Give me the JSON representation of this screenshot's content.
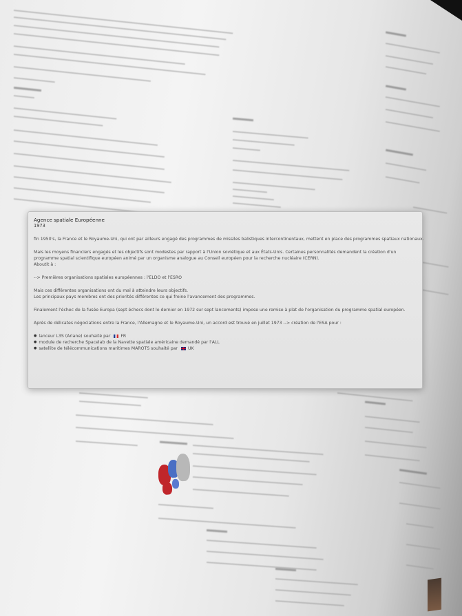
{
  "popover": {
    "title": "Agence spatiale Européenne",
    "year": "1973",
    "paragraphs": [
      "fin 1950's, la France et le Royaume-Uni, qui ont par ailleurs engagé des programmes de missiles balistiques intercontinentaux, mettent en place des programmes spatiaux nationaux.",
      "Mais les moyens financiers engagés et les objectifs sont modestes par rapport à l'Union soviétique et aux États-Unis. Certaines personnalités demandent la création d'un",
      "programme spatial scientifique européen animé par un organisme analogue au Conseil européen pour la recherche nucléaire (CERN).",
      "Aboutit à :",
      "--> Premières organisations spatiales européennes : l'ELDO et l'ESRO",
      "Mais ces différentes organisations ont du mal à atteindre leurs objectifs.",
      "Les principaux pays membres ont des priorités différentes ce qui freine l'avancement des programmes.",
      "Finalement l'échec de la fusée Europa (sept échecs dont le dernier en 1972 sur sept lancements) impose une remise à plat de l'organisation du programme spatial européen.",
      "Après de délicates négociations entre la France, l'Allemagne et le Royaume-Uni, un accord est trouvé en juillet 1973 --> création de l'ESA pour :"
    ],
    "bullets": [
      {
        "text": "lanceur L3S (Ariane) souhaité par ",
        "flag": "fr",
        "suffix": "FR"
      },
      {
        "text": "module de recherche Spacelab de la Navette spatiale américaine demandé par l'ALL",
        "flag": "",
        "suffix": ""
      },
      {
        "text": "satellite de télécommunications maritimes MAROTS souhaité par ",
        "flag": "uk",
        "suffix": "UK"
      }
    ]
  },
  "colors": {
    "popover_bg": "#e6e6e6",
    "flag_fr_blue": "#1d3c8f",
    "flag_fr_red": "#d12b2b",
    "flag_uk_blue": "#20307a",
    "flag_uk_red": "#c8102e"
  },
  "icons": {
    "bullet": "bullet-dot-icon",
    "france_flag": "france-flag-icon",
    "uk_flag": "uk-flag-icon"
  }
}
